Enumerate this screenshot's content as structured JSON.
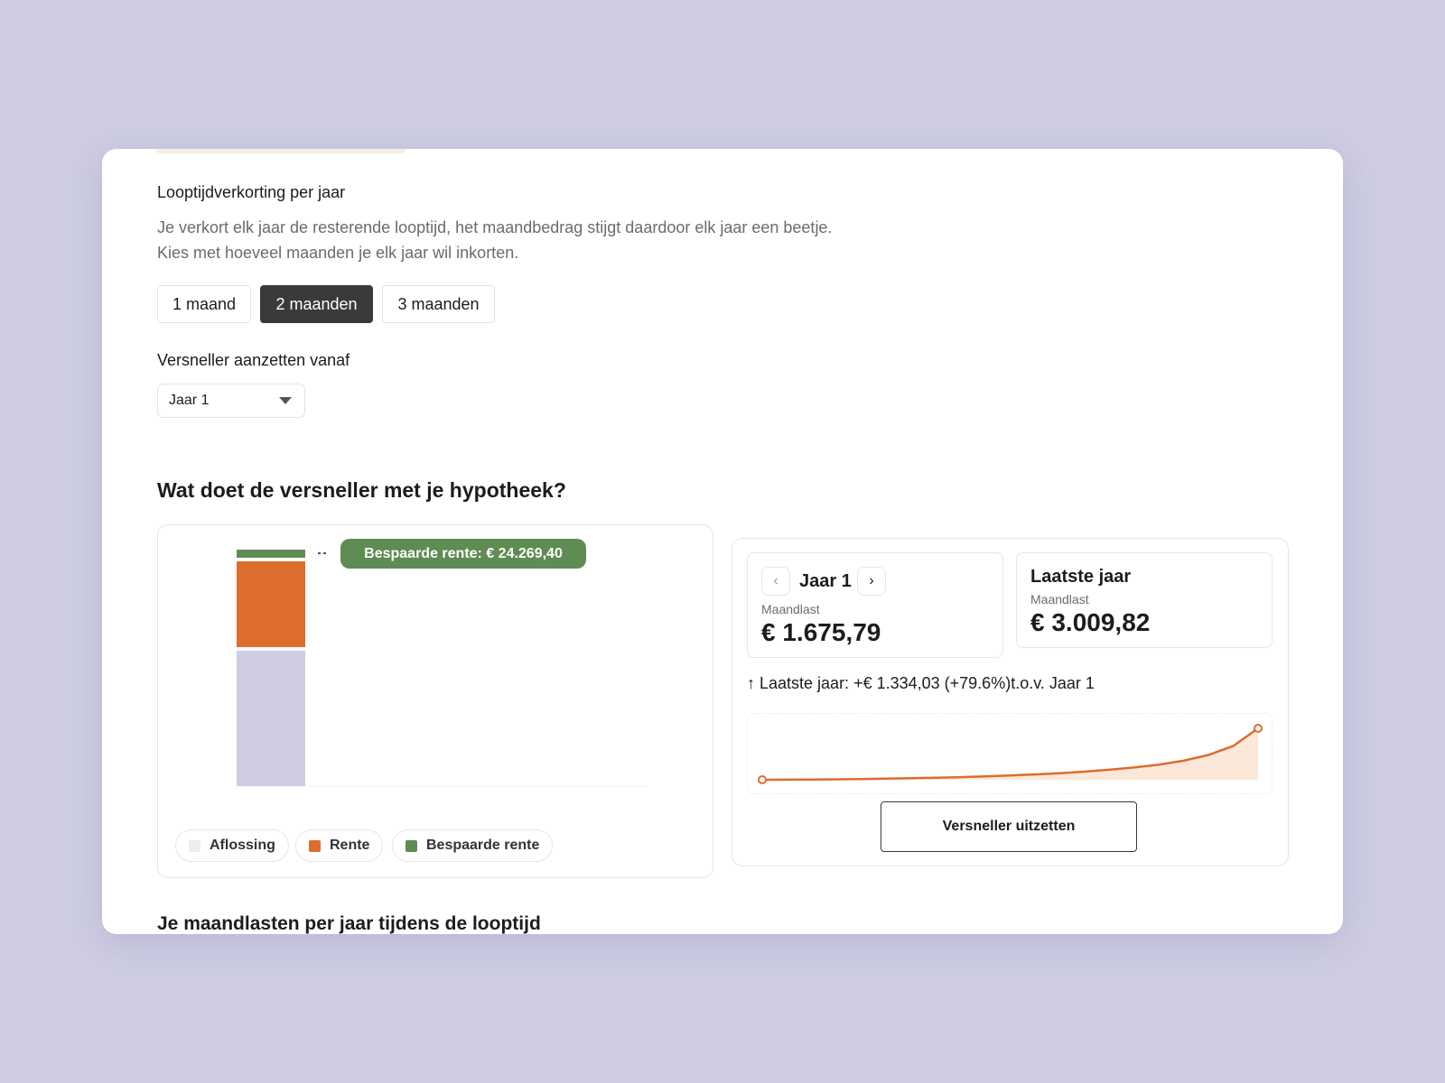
{
  "settings": {
    "section_label": "Looptijdverkorting per jaar",
    "description_line1": "Je verkort elk jaar de resterende looptijd, het maandbedrag stijgt daardoor elk jaar een beetje.",
    "description_line2": "Kies met hoeveel maanden je elk jaar wil inkorten.",
    "options": [
      {
        "label": "1 maand",
        "selected": false
      },
      {
        "label": "2 maanden",
        "selected": true
      },
      {
        "label": "3 maanden",
        "selected": false
      }
    ],
    "start_label": "Versneller aanzetten vanaf",
    "start_value": "Jaar 1"
  },
  "section_title": "Wat doet de versneller met je hypotheek?",
  "chart_panel": {
    "badge": "Bespaarde rente: € 24.269,40",
    "legend": [
      {
        "label": "Aflossing",
        "color": "#eeeeee"
      },
      {
        "label": "Rente",
        "color": "#dc6d2e"
      },
      {
        "label": "Bespaarde rente",
        "color": "#5e8c52"
      }
    ]
  },
  "chart_data": {
    "type": "bar",
    "stacked": true,
    "categories": [
      ""
    ],
    "series": [
      {
        "name": "Aflossing",
        "values": [
          150
        ],
        "color": "#cecde3"
      },
      {
        "name": "Rente",
        "values": [
          95
        ],
        "color": "#dc6d2e"
      },
      {
        "name": "Bespaarde rente",
        "values": [
          9
        ],
        "color": "#5e8c52"
      }
    ],
    "annotation": "Bespaarde rente: € 24.269,40"
  },
  "summary": {
    "year_card": {
      "prev_symbol": "‹",
      "next_symbol": "›",
      "title": "Jaar 1",
      "label": "Maandlast",
      "value": "€ 1.675,79"
    },
    "last_card": {
      "title": "Laatste jaar",
      "label": "Maandlast",
      "value": "€ 3.009,82"
    },
    "diff_text": "↑ Laatste jaar: +€ 1.334,03 (+79.6%)t.o.v. Jaar 1",
    "sparkline_values": [
      1675.79,
      1678,
      1682,
      1688,
      1695,
      1704,
      1715,
      1728,
      1744,
      1763,
      1786,
      1813,
      1846,
      1886,
      1935,
      1995,
      2070,
      2170,
      2320,
      2550,
      3009.82
    ],
    "sparkline_color": "#dc6d2e",
    "button_label": "Versneller uitzetten"
  },
  "next_section_title": "Je maandlasten per jaar tijdens de looptijd"
}
